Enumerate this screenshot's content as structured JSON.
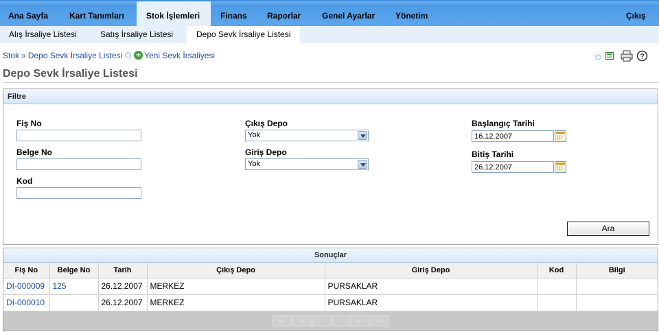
{
  "topnav": {
    "items": [
      "Ana Sayfa",
      "Kart Tanımları",
      "Stok İşlemleri",
      "Finans",
      "Raporlar",
      "Genel Ayarlar",
      "Yönetim"
    ],
    "logout": "Çıkış"
  },
  "subnav": {
    "items": [
      "Alış İrsaliye Listesi",
      "Satış İrsaliye Listesi",
      "Depo Sevk İrsaliye Listesi"
    ]
  },
  "breadcrumb": {
    "root": "Stok",
    "separator": "»",
    "current": "Depo Sevk İrsaliye Listesi",
    "new_link": "Yeni Sevk İrsaliyesi"
  },
  "page_title": "Depo Sevk İrsaliye Listesi",
  "filter": {
    "title": "Filtre",
    "fis_no_label": "Fiş No",
    "fis_no_value": "",
    "belge_no_label": "Belge No",
    "belge_no_value": "",
    "kod_label": "Kod",
    "kod_value": "",
    "cikis_depo_label": "Çıkış Depo",
    "cikis_depo_value": "Yok",
    "giris_depo_label": "Giriş Depo",
    "giris_depo_value": "Yok",
    "baslangic_label": "Başlangıç Tarihi",
    "baslangic_value": "16.12.2007",
    "bitis_label": "Bitiş Tarihi",
    "bitis_value": "26.12.2007",
    "search_button": "Ara"
  },
  "results": {
    "title": "Sonuçlar",
    "columns": [
      "Fiş No",
      "Belge No",
      "Tarih",
      "Çıkış Depo",
      "Giriş Depo",
      "Kod",
      "Bilgi"
    ],
    "rows": [
      {
        "fis_no": "DI-000009",
        "belge_no": "125",
        "tarih": "26.12.2007",
        "cikis": "MERKEZ",
        "giris": "PURSAKLAR",
        "kod": "",
        "bilgi": ""
      },
      {
        "fis_no": "DI-000010",
        "belge_no": "",
        "tarih": "26.12.2007",
        "cikis": "MERKEZ",
        "giris": "PURSAKLAR",
        "kod": "",
        "bilgi": ""
      }
    ],
    "pager": [
      "««",
      "«",
      "",
      "",
      "»",
      "»»"
    ]
  },
  "colors": {
    "nav_blue": "#5ca6ec",
    "subnav_bg": "#e6f0fb",
    "link": "#1f4f9f"
  }
}
